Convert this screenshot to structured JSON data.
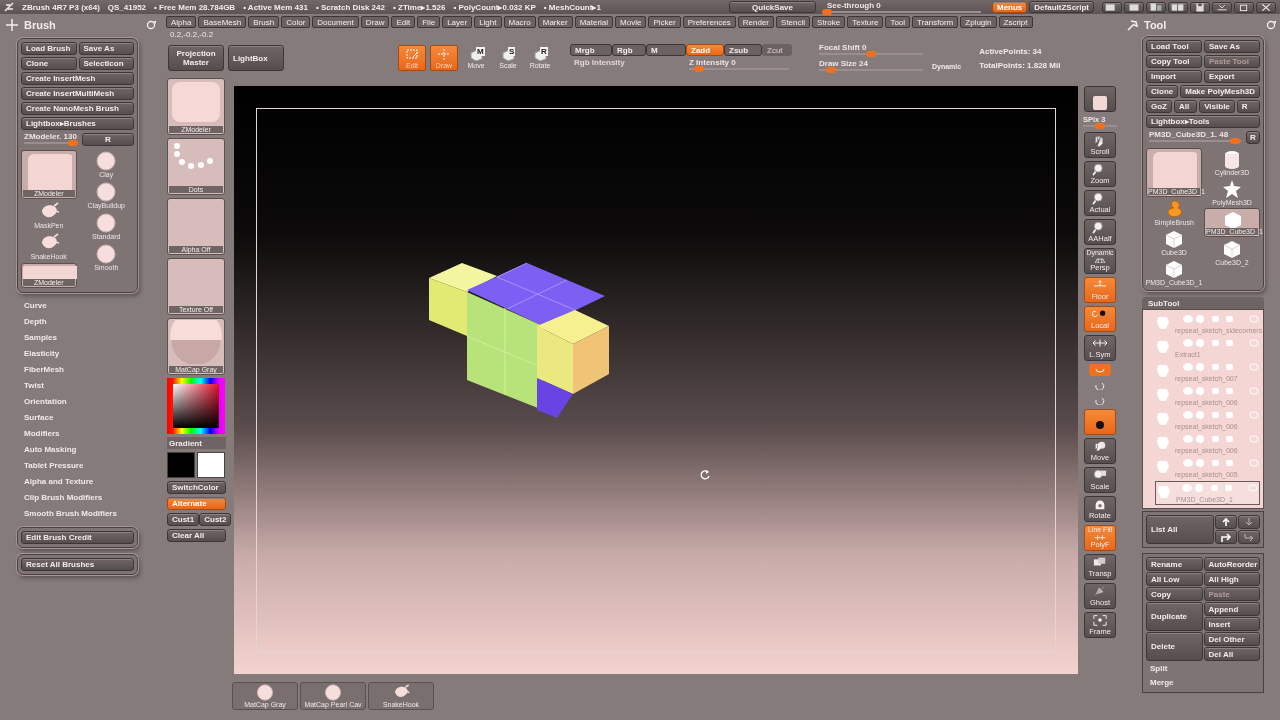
{
  "title_bar": {
    "app": "ZBrush 4R7 P3 (x64)",
    "session": "QS_41952",
    "stats": [
      "• Free Mem 28.784GB",
      "• Active Mem 431",
      "• Scratch Disk 242",
      "• ZTime▸1.526",
      "• PolyCount▸0.032 KP",
      "• MeshCount▸1"
    ],
    "quicksave": "QuickSave",
    "see_through": {
      "label": "See-through",
      "reading": "0",
      "level": 0
    },
    "menus_button": {
      "label": "Menus",
      "selected": true
    },
    "script_button": "DefaultZScript"
  },
  "menu_bar": [
    "Alpha",
    "BaseMesh",
    "Brush",
    "Color",
    "Document",
    "Draw",
    "Edit",
    "File",
    "Layer",
    "Light",
    "Macro",
    "Marker",
    "Material",
    "Movie",
    "Picker",
    "Preferences",
    "Render",
    "Stencil",
    "Stroke",
    "Texture",
    "Tool",
    "Transform",
    "Zplugin",
    "Zscript"
  ],
  "brush_palette": {
    "title": "Brush",
    "buttons": [
      [
        "Load Brush",
        "Save As"
      ],
      [
        "Clone",
        "SelectIcon"
      ],
      [
        "Create InsertMesh"
      ],
      [
        "Create InsertMultiMesh"
      ],
      [
        "Create NanoMesh Brush"
      ],
      [
        "Lightbox▸Brushes"
      ]
    ],
    "slider": {
      "label": "ZModeler. 130",
      "level": 0.93,
      "reset": "R"
    },
    "brush_columns": [
      [
        {
          "name": "ZModeler",
          "kind": "large"
        },
        {
          "name": "MaskPen",
          "kind": "splat"
        },
        {
          "name": "SnakeHook",
          "kind": "splat"
        },
        {
          "name": "ZModeler",
          "kind": "wide"
        }
      ],
      [
        {
          "name": "Clay",
          "kind": "sphere"
        },
        {
          "name": "ClayBuildup",
          "kind": "sphere"
        },
        {
          "name": "Standard",
          "kind": "sphere"
        },
        {
          "name": "Smooth",
          "kind": "sphere"
        }
      ]
    ],
    "sections": [
      "Curve",
      "Depth",
      "Samples",
      "Elasticity",
      "FiberMesh",
      "Twist",
      "Orientation",
      "Surface",
      "Modifiers",
      "Auto Masking",
      "Tablet Pressure",
      "Alpha and Texture",
      "Clip Brush Modifiers",
      "Smooth Brush Modifiers"
    ],
    "footer_buttons": [
      "Edit Brush Credit",
      "Reset All Brushes"
    ]
  },
  "top_shelf": {
    "coords": "0.2,-0.2,-0.2",
    "projection_master": "Projection Master",
    "lightbox": "LightBox",
    "modes": [
      {
        "label": "Edit",
        "kind": "edit",
        "selected": true
      },
      {
        "label": "Draw",
        "kind": "draw",
        "selected": true
      },
      {
        "label": "Move",
        "kind": "cube",
        "glyph": "M",
        "selected": false
      },
      {
        "label": "Scale",
        "kind": "cube",
        "glyph": "S",
        "selected": false
      },
      {
        "label": "Rotate",
        "kind": "cube",
        "glyph": "R",
        "selected": false
      }
    ],
    "channels": [
      {
        "label": "Mrgb",
        "selected": false
      },
      {
        "label": "Rgb",
        "selected": false
      },
      {
        "label": "M",
        "selected": false
      }
    ],
    "rgb_intensity": "Rgb Intensity",
    "depth_modes": [
      {
        "label": "Zadd",
        "selected": true,
        "disabled": false
      },
      {
        "label": "Zsub",
        "selected": false,
        "disabled": false
      },
      {
        "label": "Zcut",
        "selected": false,
        "disabled": true
      }
    ],
    "z_intensity": {
      "label": "Z Intensity 0",
      "level": 0.1
    },
    "focal_shift": {
      "label": "Focal Shift 0",
      "level": 0.5
    },
    "draw_size": {
      "label": "Draw Size 24",
      "level": 0.12
    },
    "dynamic": "Dynamic",
    "active_points": "ActivePoints: 34",
    "total_points": "TotalPoints: 1.828 Mil"
  },
  "left_shelf": {
    "thumbs": [
      {
        "label": "ZModeler",
        "kind": "brush"
      },
      {
        "label": "Dots",
        "kind": "dots"
      },
      {
        "label": "Alpha Off",
        "kind": "blank"
      },
      {
        "label": "Texture Off",
        "kind": "blank"
      },
      {
        "label": "MatCap Gray",
        "kind": "matcap"
      }
    ],
    "gradient": "Gradient",
    "switch_color": "SwitchColor",
    "alternate": {
      "label": "Alternate",
      "on": true
    },
    "cust": [
      "Cust1",
      "Cust2"
    ],
    "clear_all": "Clear All"
  },
  "right_shelf": [
    {
      "kind": "render",
      "on": false
    },
    {
      "kind": "slider",
      "label": "SPix 3",
      "level": 0.5
    },
    {
      "kind": "scroll",
      "label": "Scroll",
      "on": false
    },
    {
      "kind": "zoom",
      "label": "Zoom",
      "on": false
    },
    {
      "kind": "zoom",
      "label": "Actual",
      "on": false
    },
    {
      "kind": "zoom",
      "label": "AAHalf",
      "on": false
    },
    {
      "kind": "persp",
      "label": "Persp",
      "caption": "Dynamic",
      "on": false
    },
    {
      "kind": "floor",
      "label": "Floor",
      "on": true
    },
    {
      "kind": "local",
      "label": "Local",
      "on": true
    },
    {
      "kind": "sym",
      "label": "L.Sym",
      "on": false
    },
    {
      "kind": "xyz",
      "on": true
    },
    {
      "kind": "axis",
      "on": false
    },
    {
      "kind": "axis",
      "on": false
    },
    {
      "kind": "solo",
      "on": true
    },
    {
      "kind": "move",
      "label": "Move",
      "on": false
    },
    {
      "kind": "scale",
      "label": "Scale",
      "on": false
    },
    {
      "kind": "rotate",
      "label": "Rotate",
      "on": false
    },
    {
      "kind": "polyf",
      "label": "PolyF",
      "caption": "Line Fill",
      "on": true
    },
    {
      "kind": "transp",
      "label": "Transp",
      "on": false
    },
    {
      "kind": "ghost",
      "label": "Ghost",
      "on": false
    },
    {
      "kind": "frame",
      "label": "Frame",
      "on": false
    }
  ],
  "tool_palette": {
    "title": "Tool",
    "buttons": [
      [
        {
          "label": "Load Tool",
          "disabled": false
        },
        {
          "label": "Save As",
          "disabled": false
        }
      ],
      [
        {
          "label": "Copy Tool",
          "disabled": false
        },
        {
          "label": "Paste Tool",
          "disabled": true
        }
      ],
      [
        {
          "label": "Import",
          "disabled": false
        },
        {
          "label": "Export",
          "disabled": false
        }
      ],
      [
        {
          "label": "Clone",
          "disabled": false
        },
        {
          "label": "Make PolyMesh3D",
          "disabled": false
        }
      ],
      [
        {
          "label": "GoZ",
          "disabled": false
        },
        {
          "label": "All",
          "disabled": false
        },
        {
          "label": "Visible",
          "disabled": false
        },
        {
          "label": "R",
          "disabled": false
        }
      ],
      [
        {
          "label": "Lightbox▸Tools",
          "disabled": false
        }
      ]
    ],
    "slider": {
      "label": "PM3D_Cube3D_1. 48",
      "level": 0.93,
      "reset": "R"
    },
    "tool_columns": [
      [
        {
          "name": "PM3D_Cube3D_1",
          "kind": "large"
        },
        {
          "name": "SimpleBrush",
          "kind": "simple"
        },
        {
          "name": "Cube3D",
          "kind": "cube"
        },
        {
          "name": "PM3D_Cube3D_1",
          "kind": "cube"
        }
      ],
      [
        {
          "name": "Cylinder3D",
          "kind": "cylinder"
        },
        {
          "name": "PolyMesh3D",
          "kind": "star"
        },
        {
          "name": "PM3D_Cube3D_1",
          "kind": "boxed"
        },
        {
          "name": "Cube3D_2",
          "kind": "cube"
        }
      ]
    ],
    "subtool": {
      "title": "SubTool",
      "items": [
        {
          "name": "repseal_sketch_sidecorners",
          "selected": false
        },
        {
          "name": "Extract1",
          "selected": false
        },
        {
          "name": "repseal_sketch_007",
          "selected": false
        },
        {
          "name": "repseal_sketch_006",
          "selected": false
        },
        {
          "name": "repseal_sketch_006",
          "selected": false
        },
        {
          "name": "repseal_sketch_006",
          "selected": false
        },
        {
          "name": "repseal_sketch_005",
          "selected": false
        },
        {
          "name": "PM3D_Cube3D_1",
          "selected": true
        }
      ],
      "list_all": "List All",
      "button_columns": [
        [
          {
            "label": "Rename",
            "kind": "normal",
            "disabled": false
          },
          {
            "label": "All Low",
            "kind": "normal",
            "disabled": false
          },
          {
            "label": "Copy",
            "kind": "normal",
            "disabled": false
          },
          {
            "label": "Duplicate",
            "kind": "tall",
            "disabled": false
          },
          {
            "label": "Delete",
            "kind": "tall",
            "disabled": false
          }
        ],
        [
          {
            "label": "AutoReorder",
            "kind": "normal",
            "disabled": false
          },
          {
            "label": "All High",
            "kind": "normal",
            "disabled": false
          },
          {
            "label": "Paste",
            "kind": "normal",
            "disabled": true
          },
          {
            "label": "Append",
            "kind": "normal",
            "disabled": false
          },
          {
            "label": "Insert",
            "kind": "normal",
            "disabled": false
          },
          {
            "label": "Del Other",
            "kind": "normal",
            "disabled": false
          },
          {
            "label": "Del All",
            "kind": "normal",
            "disabled": false
          }
        ]
      ],
      "sections": [
        "Split",
        "Merge"
      ]
    }
  },
  "bottom_shelf": [
    {
      "label": "MatCap Gray",
      "kind": "sphere"
    },
    {
      "label": "MatCap Pearl Cav",
      "kind": "sphere"
    },
    {
      "label": "SnakeHook",
      "kind": "splat"
    }
  ]
}
